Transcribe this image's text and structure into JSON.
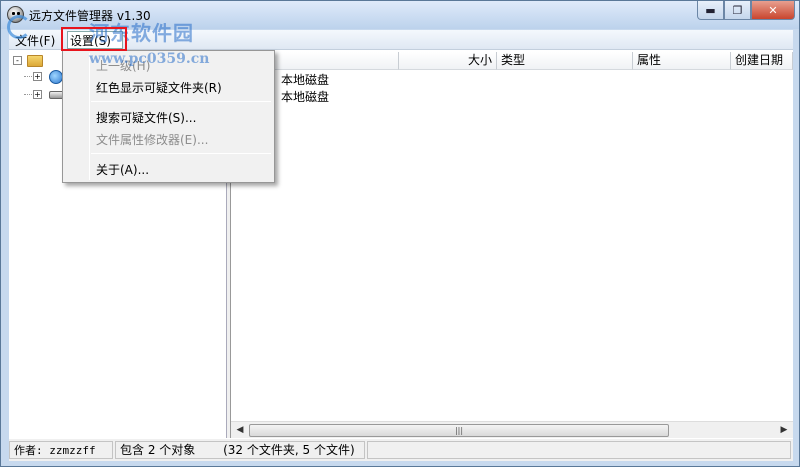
{
  "window": {
    "title": "远方文件管理器 v1.30",
    "controls": {
      "minimize": "▬",
      "maximize": "❐",
      "close": "✕"
    }
  },
  "watermark": {
    "brand": "河东软件园",
    "url": "www.pc0359.cn"
  },
  "menubar": {
    "items": [
      {
        "label": "文件(F)"
      },
      {
        "label": "设置(S)"
      }
    ]
  },
  "settings_menu": {
    "items": [
      {
        "label": "上一级(H)",
        "enabled": false
      },
      {
        "label": "红色显示可疑文件夹(R)",
        "enabled": true
      },
      {
        "label": "搜索可疑文件(S)...",
        "enabled": true
      },
      {
        "label": "文件属性修改器(E)...",
        "enabled": false
      },
      {
        "label": "关于(A)...",
        "enabled": true
      }
    ]
  },
  "tree": {
    "expanders": [
      "-",
      "+",
      "+"
    ]
  },
  "file_list": {
    "columns": [
      {
        "label": ""
      },
      {
        "label": "大小"
      },
      {
        "label": "类型"
      },
      {
        "label": "属性"
      },
      {
        "label": "创建日期"
      }
    ],
    "rows": [
      {
        "type": "本地磁盘"
      },
      {
        "type": "本地磁盘"
      }
    ]
  },
  "scrollbar": {
    "left_arrow": "◀",
    "right_arrow": "▶",
    "grip": "|||"
  },
  "statusbar": {
    "author": "作者: zzmzzff",
    "count": "包含 2 个对象",
    "detail": "(32 个文件夹, 5 个文件)"
  }
}
